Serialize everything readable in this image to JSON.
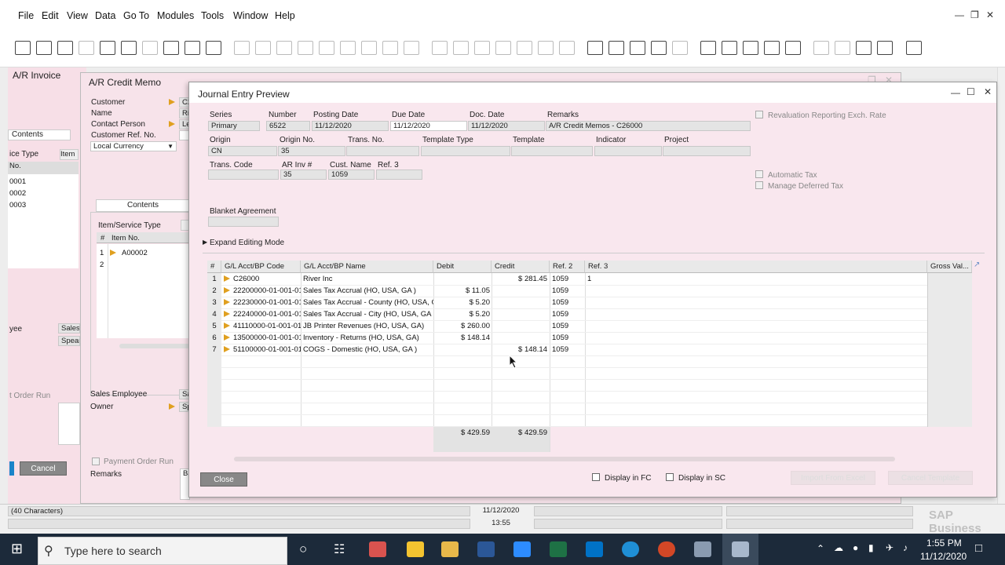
{
  "menu": {
    "items": [
      "File",
      "Edit",
      "View",
      "Data",
      "Go To",
      "Modules",
      "Tools",
      "Window",
      "Help"
    ]
  },
  "invoice_window": {
    "title": "A/R Invoice",
    "tab": "Contents",
    "col_type": "ice Type",
    "col_item": "Item",
    "col_no": "No.",
    "rows": [
      "0001",
      "0002",
      "0003"
    ],
    "employee_label": "yee",
    "employee_value": "Sales E",
    "owner_value": "Spear",
    "order_run": "t Order Run",
    "cancel_label": "Cancel"
  },
  "credit_memo": {
    "title": "A/R Credit Memo",
    "customer_label": "Customer",
    "customer_value": "C2",
    "name_label": "Name",
    "name_value": "Riv",
    "contact_label": "Contact Person",
    "contact_value": "Le",
    "ref_label": "Customer Ref. No.",
    "currency": "Local Currency",
    "tab_contents": "Contents",
    "col_item_type": "Item/Service Type",
    "col_hash": "#",
    "col_item_no": "Item No.",
    "row1_num": "1",
    "row1_item": "A00002",
    "row2_num": "2",
    "sales_employee_label": "Sales Employee",
    "sales_employee_value": "Sa",
    "owner_label": "Owner",
    "owner_value": "Sp",
    "payment_order_run": "Payment Order Run",
    "remarks_label": "Remarks",
    "remarks_value": "Ba"
  },
  "journal": {
    "title": "Journal Entry Preview",
    "series_label": "Series",
    "series_value": "Primary",
    "number_label": "Number",
    "number_value": "6522",
    "posting_label": "Posting Date",
    "posting_value": "11/12/2020",
    "due_label": "Due Date",
    "due_value": "11/12/2020",
    "doc_label": "Doc. Date",
    "doc_value": "11/12/2020",
    "remarks_label": "Remarks",
    "remarks_value": "A/R Credit Memos - C26000",
    "origin_label": "Origin",
    "origin_value": "CN",
    "origin_no_label": "Origin No.",
    "origin_no_value": "35",
    "trans_no_label": "Trans. No.",
    "template_type_label": "Template Type",
    "template_label": "Template",
    "indicator_label": "Indicator",
    "project_label": "Project",
    "trans_code_label": "Trans. Code",
    "ar_inv_label": "AR Inv #",
    "ar_inv_value": "35",
    "cust_name_label": "Cust. Name",
    "cust_name_value": "1059",
    "ref3_label": "Ref. 3",
    "blanket_label": "Blanket Agreement",
    "reval_label": "Revaluation Reporting Exch. Rate",
    "auto_tax_label": "Automatic Tax",
    "deferred_tax_label": "Manage Deferred Tax",
    "expand_label": "Expand Editing Mode",
    "columns": [
      "#",
      "G/L Acct/BP Code",
      "G/L Acct/BP Name",
      "Debit",
      "Credit",
      "Ref. 2",
      "Ref. 3",
      "Gross Val..."
    ],
    "rows": [
      {
        "num": "1",
        "code": "C26000",
        "name": "River Inc",
        "debit": "",
        "credit": "$ 281.45",
        "ref2": "1059",
        "ref3": "1"
      },
      {
        "num": "2",
        "code": "22200000-01-001-01",
        "name": "Sales Tax Accrual (HO, USA, GA )",
        "debit": "$ 11.05",
        "credit": "",
        "ref2": "1059",
        "ref3": ""
      },
      {
        "num": "3",
        "code": "22230000-01-001-01",
        "name": "Sales Tax Accrual - County (HO, USA, G",
        "debit": "$ 5.20",
        "credit": "",
        "ref2": "1059",
        "ref3": ""
      },
      {
        "num": "4",
        "code": "22240000-01-001-01",
        "name": "Sales Tax Accrual - City (HO, USA, GA",
        "debit": "$ 5.20",
        "credit": "",
        "ref2": "1059",
        "ref3": ""
      },
      {
        "num": "5",
        "code": "41110000-01-001-01",
        "name": "JB Printer Revenues (HO, USA, GA)",
        "debit": "$ 260.00",
        "credit": "",
        "ref2": "1059",
        "ref3": ""
      },
      {
        "num": "6",
        "code": "13500000-01-001-01",
        "name": "Inventory - Returns (HO, USA, GA)",
        "debit": "$ 148.14",
        "credit": "",
        "ref2": "1059",
        "ref3": ""
      },
      {
        "num": "7",
        "code": "51100000-01-001-01",
        "name": "COGS - Domestic (HO, USA, GA )",
        "debit": "",
        "credit": "$ 148.14",
        "ref2": "1059",
        "ref3": ""
      }
    ],
    "total_debit": "$ 429.59",
    "total_credit": "$ 429.59",
    "close_label": "Close",
    "display_fc_label": "Display in FC",
    "display_sc_label": "Display in SC",
    "import_label": "Import From Excel",
    "cancel_template_label": "Cancel Template"
  },
  "statusbar": {
    "message": "(40 Characters)",
    "date": "11/12/2020",
    "time": "13:55",
    "logo": "SAP Business One"
  },
  "taskbar": {
    "search_placeholder": "Type here to search",
    "clock_time": "1:55 PM",
    "clock_date": "11/12/2020"
  }
}
